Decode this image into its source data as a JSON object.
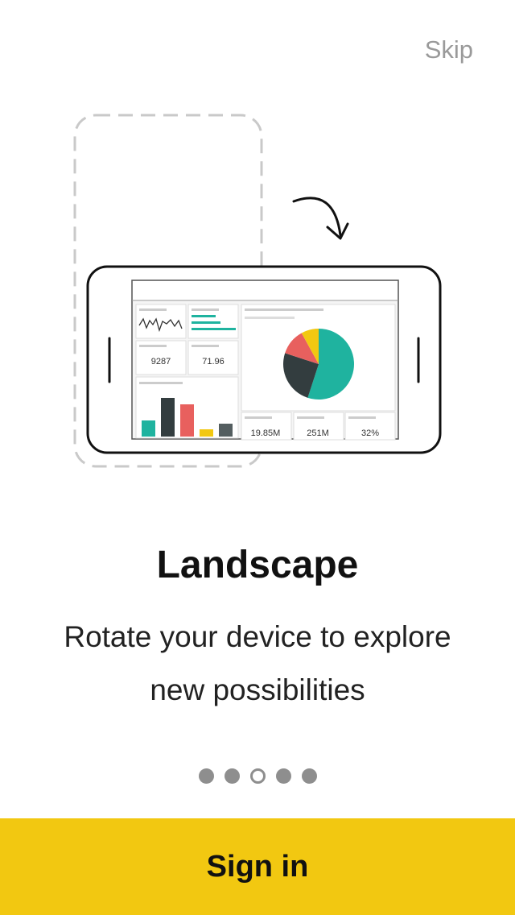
{
  "header": {
    "skip_label": "Skip"
  },
  "illustration": {
    "kpis_top": [
      "9287",
      "71.96"
    ],
    "kpis_bottom": [
      "19.85M",
      "251M",
      "32%"
    ],
    "bar_chart": {
      "values": [
        20,
        48,
        40,
        9,
        16
      ],
      "colors": [
        "#1fb39f",
        "#333d3f",
        "#e8605e",
        "#f2c811",
        "#545e60"
      ]
    },
    "pie_chart": {
      "values": [
        55,
        25,
        12,
        8
      ],
      "colors": [
        "#1fb39f",
        "#333d3f",
        "#e8605e",
        "#f2c811"
      ]
    }
  },
  "content": {
    "title": "Landscape",
    "description": "Rotate your device to explore new possibilities"
  },
  "pagination": {
    "total": 5,
    "active_index": 2
  },
  "footer": {
    "signin_label": "Sign in"
  }
}
